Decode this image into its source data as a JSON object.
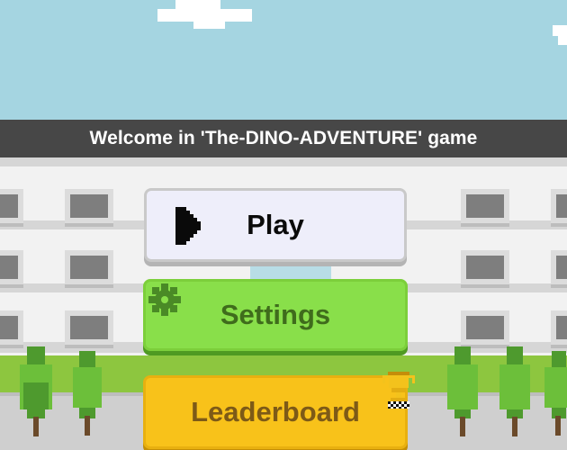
{
  "banner": {
    "text": "Welcome in 'The-DINO-ADVENTURE' game"
  },
  "menu": {
    "play_label": "Play",
    "settings_label": "Settings",
    "leaderboard_label": "Leaderboard"
  },
  "icons": {
    "play": "play-icon",
    "settings": "gear-icon",
    "leaderboard": "trophy-icon"
  },
  "colors": {
    "sky": "#a5d5e1",
    "banner": "#474747",
    "play_button": "#eeeefa",
    "settings_button": "#89df4a",
    "leaderboard_button": "#f8c21a"
  }
}
